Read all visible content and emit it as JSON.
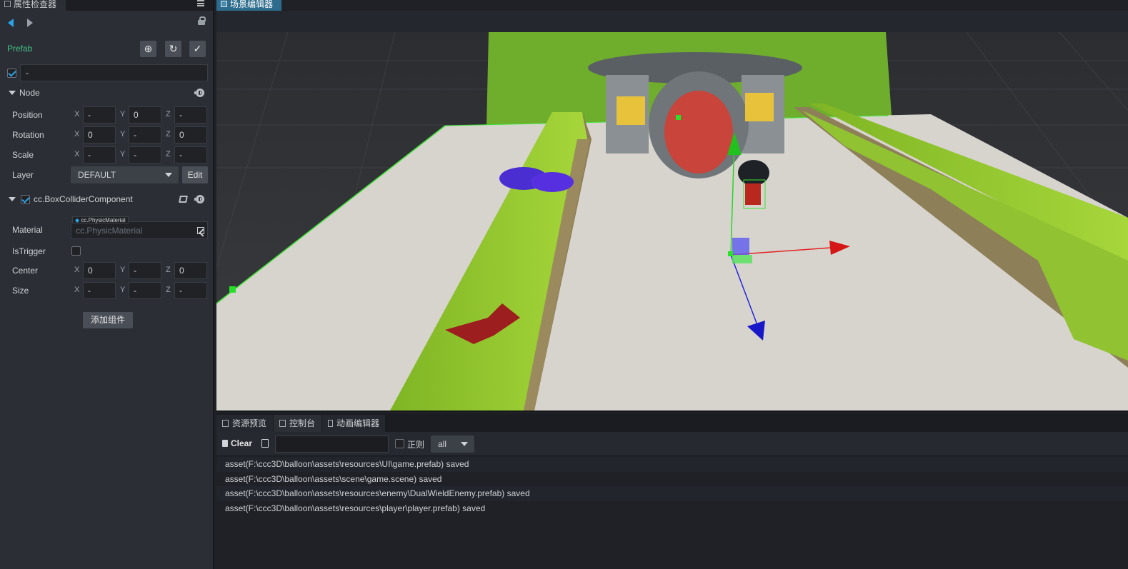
{
  "tabs": {
    "inspector": "属性检查器",
    "scene": "场景编辑器"
  },
  "inspector": {
    "prefab_label": "Prefab",
    "node_name": "-",
    "node_section": "Node",
    "position": {
      "label": "Position",
      "x": "-",
      "y": "0",
      "z": "-"
    },
    "rotation": {
      "label": "Rotation",
      "x": "0",
      "y": "-",
      "z": "0"
    },
    "scale": {
      "label": "Scale",
      "x": "-",
      "y": "-",
      "z": "-"
    },
    "layer": {
      "label": "Layer",
      "value": "DEFAULT",
      "edit_label": "Edit"
    },
    "axis": {
      "x": "X",
      "y": "Y",
      "z": "Z"
    },
    "component": {
      "title": "cc.BoxColliderComponent",
      "material_label": "Material",
      "material_tag": "cc.PhysicMaterial",
      "material_placeholder": "cc.PhysicMaterial",
      "istrigger_label": "IsTrigger",
      "center": {
        "label": "Center",
        "x": "0",
        "y": "-",
        "z": "0"
      },
      "size": {
        "label": "Size",
        "x": "-",
        "y": "-",
        "z": "-"
      }
    },
    "add_component": "添加组件"
  },
  "console": {
    "tabs": [
      "资源预览",
      "控制台",
      "动画编辑器"
    ],
    "clear_label": "Clear",
    "regex_label": "正则",
    "level_value": "all",
    "logs": [
      "asset(F:\\ccc3D\\balloon\\assets\\resources\\UI\\game.prefab) saved",
      "asset(F:\\ccc3D\\balloon\\assets\\scene\\game.scene) saved",
      "asset(F:\\ccc3D\\balloon\\assets\\resources\\enemy\\DualWieldEnemy.prefab) saved",
      "asset(F:\\ccc3D\\balloon\\assets\\resources\\player\\player.prefab) saved"
    ]
  },
  "colors": {
    "accent_blue": "#2aa6e8",
    "prefab_green": "#40c48a",
    "scene_tab": "#2d6c8c"
  }
}
